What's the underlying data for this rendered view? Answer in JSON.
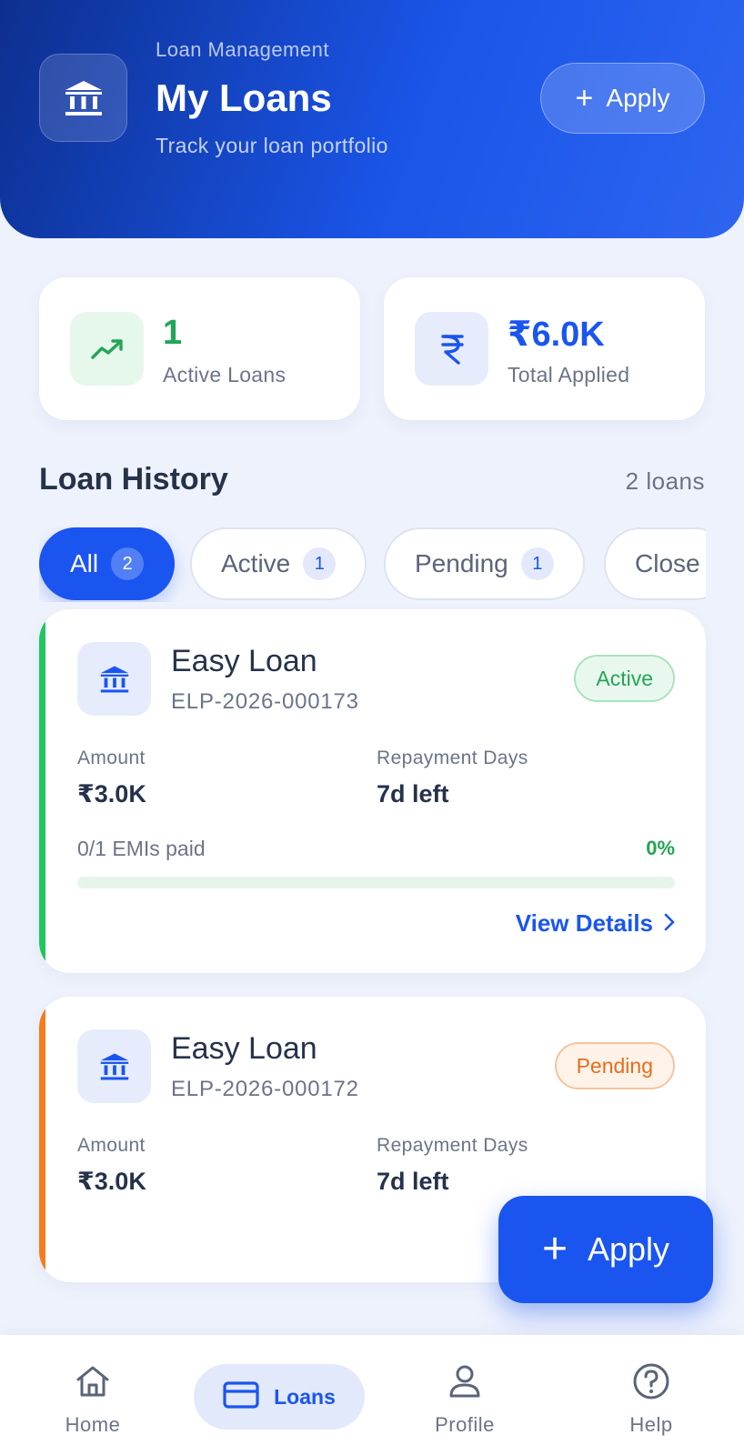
{
  "header": {
    "eyebrow": "Loan Management",
    "title": "My Loans",
    "subtitle": "Track your loan portfolio",
    "apply_label": "Apply",
    "logo_icon": "bank-icon",
    "apply_icon": "plus-icon"
  },
  "stats": {
    "active": {
      "value": "1",
      "label": "Active Loans",
      "icon": "trending-up-icon",
      "color": "#22a556"
    },
    "applied": {
      "value": "₹6.0K",
      "label": "Total Applied",
      "icon": "rupee-icon",
      "color": "#1a55f0"
    }
  },
  "history": {
    "title": "Loan History",
    "count": "2 loans",
    "filters": [
      {
        "label": "All",
        "count": "2",
        "selected": true
      },
      {
        "label": "Active",
        "count": "1",
        "selected": false
      },
      {
        "label": "Pending",
        "count": "1",
        "selected": false
      },
      {
        "label": "Close",
        "count": "",
        "selected": false
      }
    ]
  },
  "loans": [
    {
      "name": "Easy Loan",
      "id": "ELP-2026-000173",
      "status": "Active",
      "status_color": "#22a556",
      "amount_label": "Amount",
      "amount": "₹3.0K",
      "repay_label": "Repayment Days",
      "repay": "7d left",
      "emi_text": "0/1 EMIs paid",
      "emi_percent": "0%",
      "emi_progress": 0,
      "details_label": "View Details"
    },
    {
      "name": "Easy Loan",
      "id": "ELP-2026-000172",
      "status": "Pending",
      "status_color": "#e46e1d",
      "amount_label": "Amount",
      "amount": "₹3.0K",
      "repay_label": "Repayment Days",
      "repay": "7d left"
    }
  ],
  "fab": {
    "label": "Apply",
    "icon": "plus-icon"
  },
  "nav": {
    "home": "Home",
    "loans": "Loans",
    "profile": "Profile",
    "help": "Help"
  }
}
